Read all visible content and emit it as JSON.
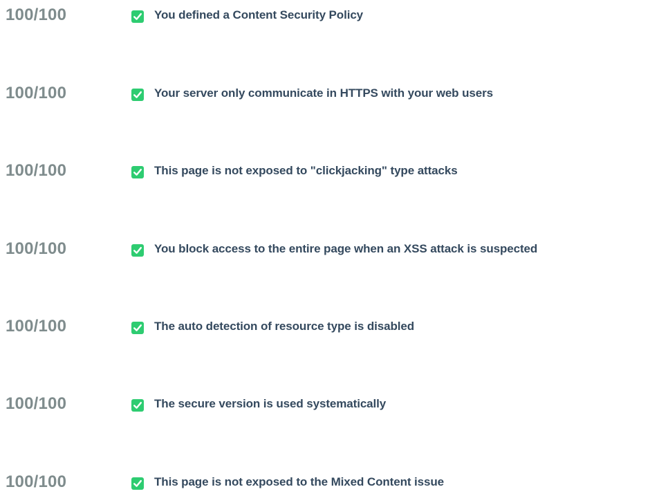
{
  "accent_color": "#2ecc71",
  "checks": [
    {
      "score": "100/100",
      "icon": "check-icon",
      "text": "You defined a Content Security Policy"
    },
    {
      "score": "100/100",
      "icon": "check-icon",
      "text": "Your server only communicate in HTTPS with your web users"
    },
    {
      "score": "100/100",
      "icon": "check-icon",
      "text": "This page is not exposed to \"clickjacking\" type attacks"
    },
    {
      "score": "100/100",
      "icon": "check-icon",
      "text": "You block access to the entire page when an XSS attack is suspected"
    },
    {
      "score": "100/100",
      "icon": "check-icon",
      "text": "The auto detection of resource type is disabled"
    },
    {
      "score": "100/100",
      "icon": "check-icon",
      "text": "The secure version is used systematically"
    },
    {
      "score": "100/100",
      "icon": "check-icon",
      "text": "This page is not exposed to the Mixed Content issue"
    }
  ]
}
